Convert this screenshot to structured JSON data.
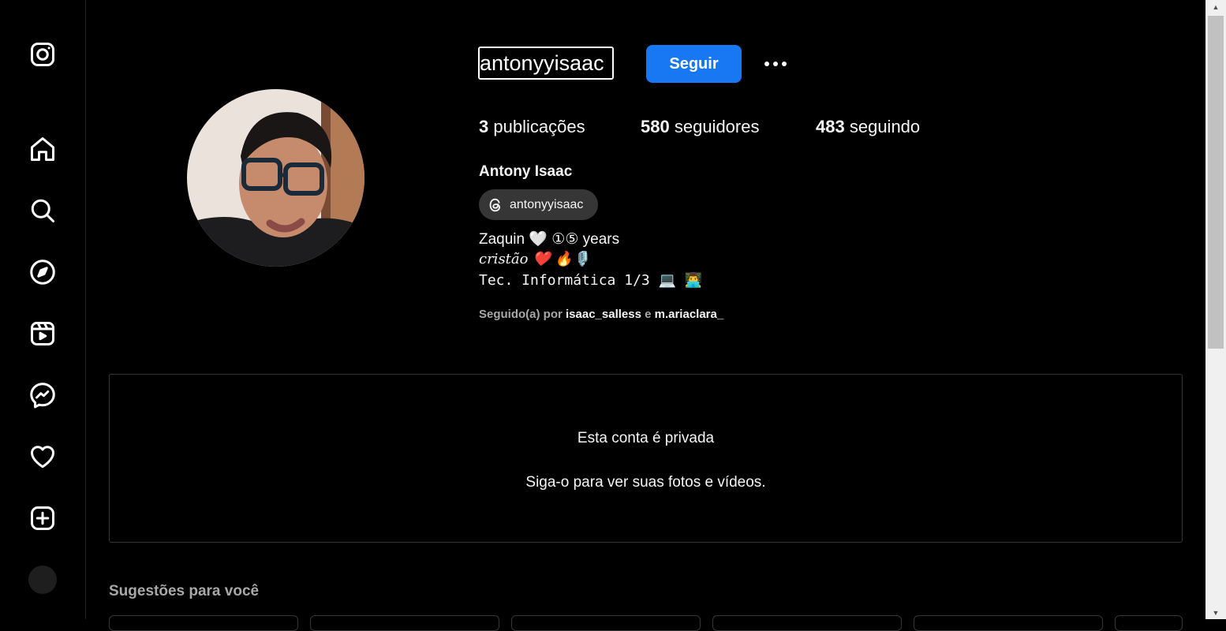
{
  "sidebar": {
    "items": [
      {
        "name": "instagram-icon",
        "label": "Instagram"
      },
      {
        "name": "home-icon",
        "label": "Página inicial"
      },
      {
        "name": "search-icon",
        "label": "Pesquisa"
      },
      {
        "name": "explore-icon",
        "label": "Explorar"
      },
      {
        "name": "reels-icon",
        "label": "Reels"
      },
      {
        "name": "messenger-icon",
        "label": "Mensagens"
      },
      {
        "name": "heart-icon",
        "label": "Notificações"
      },
      {
        "name": "create-icon",
        "label": "Criar"
      },
      {
        "name": "avatar",
        "label": "Perfil"
      }
    ]
  },
  "profile": {
    "username": "antonyyisaac",
    "follow_label": "Seguir",
    "stats": {
      "posts_count": "3",
      "posts_label": "publicações",
      "followers_count": "580",
      "followers_label": "seguidores",
      "following_count": "483",
      "following_label": "seguindo"
    },
    "full_name": "Antony Isaac",
    "threads_handle": "antonyyisaac",
    "bio": {
      "line1": "Zaquin 🤍 ①⑤ years",
      "line2": "𝑐𝑟𝑖𝑠𝑡𝑎̃𝑜 ❤️ 🔥🎙️",
      "line3": "Tec. Informática 1/3 💻 👨‍💻"
    },
    "followed_by": {
      "prefix": "Seguido(a) por ",
      "user1": "isaac_salless",
      "conj": " e ",
      "user2": "m.ariaclara_"
    }
  },
  "private": {
    "title": "Esta conta é privada",
    "subtitle": "Siga-o para ver suas fotos e vídeos."
  },
  "suggestions": {
    "title": "Sugestões para você"
  },
  "colors": {
    "background": "#000000",
    "accent": "#1877f2",
    "border": "#363636"
  }
}
